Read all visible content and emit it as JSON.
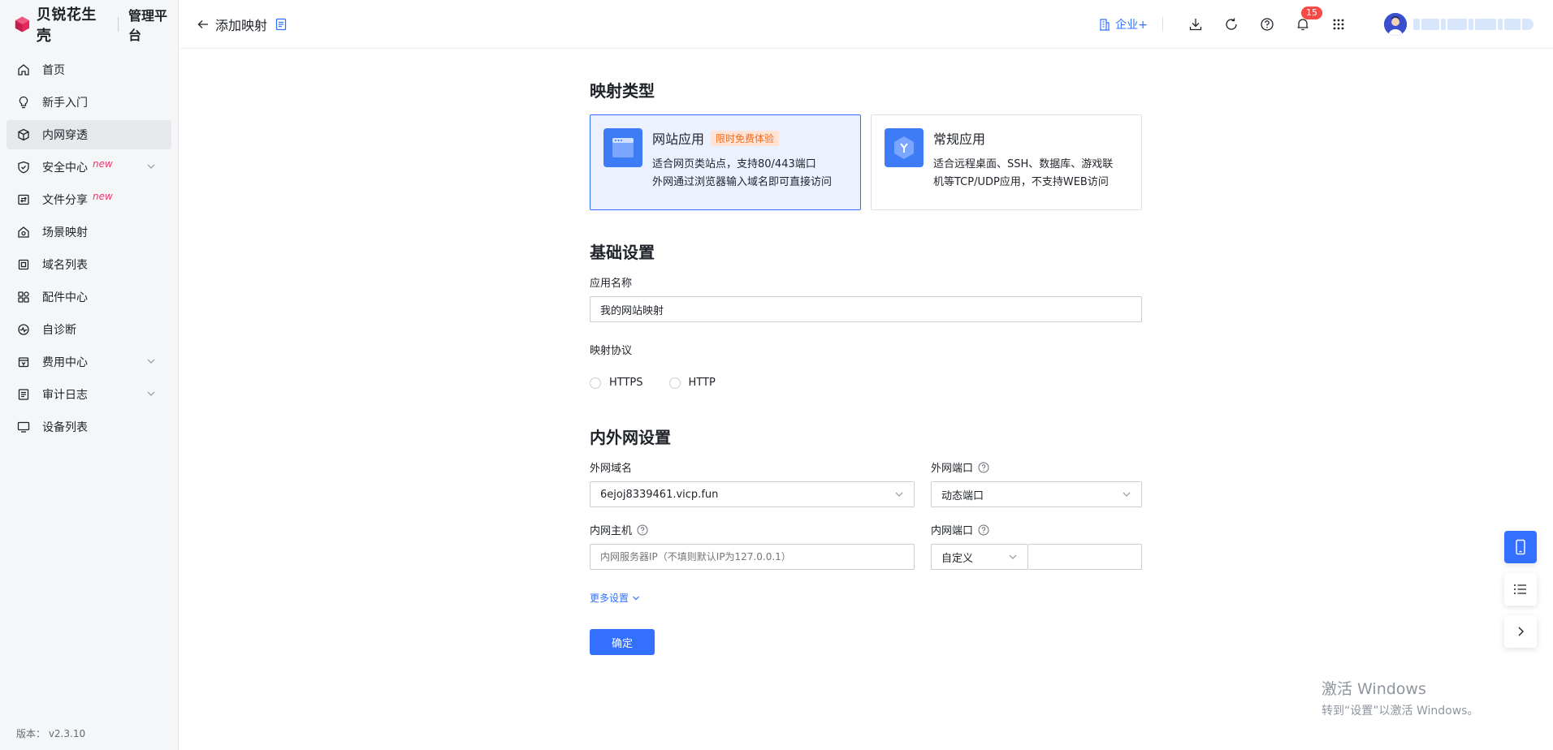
{
  "brand": {
    "name": "贝锐花生壳",
    "subtitle": "管理平台"
  },
  "sidebar": {
    "items": [
      {
        "label": "首页",
        "icon": "home-icon"
      },
      {
        "label": "新手入门",
        "icon": "lightbulb-icon"
      },
      {
        "label": "内网穿透",
        "icon": "cube-icon",
        "active": true
      },
      {
        "label": "安全中心",
        "icon": "shield-icon",
        "badge": "new",
        "expandable": true
      },
      {
        "label": "文件分享",
        "icon": "folder-share-icon",
        "badge": "new"
      },
      {
        "label": "场景映射",
        "icon": "scene-icon"
      },
      {
        "label": "域名列表",
        "icon": "domain-icon"
      },
      {
        "label": "配件中心",
        "icon": "apps-icon"
      },
      {
        "label": "自诊断",
        "icon": "diagnose-icon"
      },
      {
        "label": "费用中心",
        "icon": "billing-icon",
        "expandable": true
      },
      {
        "label": "审计日志",
        "icon": "audit-log-icon",
        "expandable": true
      },
      {
        "label": "设备列表",
        "icon": "monitor-icon"
      }
    ],
    "version": "版本：  v2.3.10"
  },
  "header": {
    "title": "添加映射",
    "enterprise_label": "企业+",
    "notification_count": "15"
  },
  "form": {
    "mapping_type": {
      "title": "映射类型",
      "options": [
        {
          "title": "网站应用",
          "tag": "限时免费体验",
          "desc_line1": "适合网页类站点，支持80/443端口",
          "desc_line2": "外网通过浏览器输入域名即可直接访问",
          "selected": true
        },
        {
          "title": "常规应用",
          "desc_line1": "适合远程桌面、SSH、数据库、游戏联",
          "desc_line2": "机等TCP/UDP应用，不支持WEB访问",
          "selected": false
        }
      ]
    },
    "basic": {
      "title": "基础设置",
      "app_name_label": "应用名称",
      "app_name_value": "我的网站映射",
      "protocol_label": "映射协议",
      "protocol_options": [
        "HTTPS",
        "HTTP"
      ]
    },
    "network": {
      "title": "内外网设置",
      "ext_domain_label": "外网域名",
      "ext_domain_value": "6ejoj8339461.vicp.fun",
      "ext_port_label": "外网端口",
      "ext_port_value": "动态端口",
      "int_host_label": "内网主机",
      "int_host_placeholder": "内网服务器IP（不填则默认IP为127.0.0.1）",
      "int_port_label": "内网端口",
      "int_port_mode": "自定义",
      "int_port_value": ""
    },
    "more_settings": "更多设置",
    "submit": "确定"
  },
  "watermark": {
    "title": "激活 Windows",
    "subtitle": "转到“设置”以激活 Windows。"
  },
  "colors": {
    "primary": "#3370ff",
    "brand": "#e8265a",
    "tag_bg": "#ffe4d6",
    "tag_text": "#f26a21"
  }
}
